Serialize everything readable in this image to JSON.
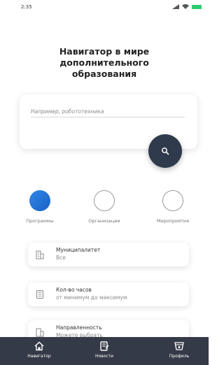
{
  "status_bar": {
    "time": "2:35"
  },
  "header": {
    "title": "Навигатор в мире\nдополнительного\nобразования"
  },
  "search": {
    "placeholder": "Например, робототехника"
  },
  "categories": [
    {
      "label": "Программы",
      "active": true
    },
    {
      "label": "Организации",
      "active": false
    },
    {
      "label": "Мероприятия",
      "active": false
    }
  ],
  "filters": [
    {
      "title": "Муниципалитет",
      "value": "Все",
      "icon": "building-icon"
    },
    {
      "title": "Кол-во часов",
      "value": "от минимум до максимум",
      "icon": "calculator-icon"
    },
    {
      "title": "Направленность",
      "value": "Можете выбрать",
      "icon": "building-icon"
    }
  ],
  "bottom_nav": [
    {
      "label": "Навигатор",
      "icon": "home-icon"
    },
    {
      "label": "Новости",
      "icon": "news-icon"
    },
    {
      "label": "Профиль",
      "icon": "profile-icon"
    }
  ],
  "colors": {
    "accent": "#1f6fd6",
    "nav_background": "#343a47",
    "search_button": "#2f3a4d"
  }
}
